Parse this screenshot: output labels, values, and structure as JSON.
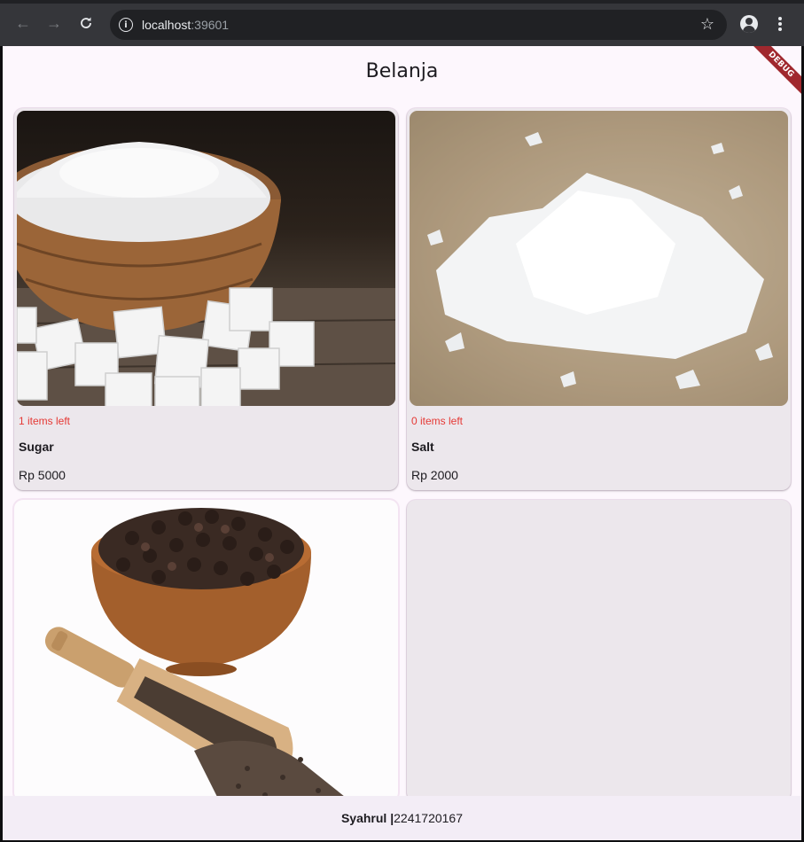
{
  "browser": {
    "url_host": "localhost",
    "url_port": ":39601",
    "back_icon": "arrow-left-icon",
    "forward_icon": "arrow-right-icon",
    "reload_icon": "reload-icon",
    "info_icon": "info-icon",
    "star_icon": "star-icon",
    "profile_icon": "profile-icon",
    "menu_icon": "kebab-menu-icon"
  },
  "app": {
    "title": "Belanja",
    "debug_banner": "DEBUG"
  },
  "products": [
    {
      "name": "Sugar",
      "stock_text": "1 items left",
      "price_text": "Rp 5000",
      "image": "sugar-image"
    },
    {
      "name": "Salt",
      "stock_text": "0 items left",
      "price_text": "Rp 2000",
      "image": "salt-image"
    },
    {
      "name": "",
      "stock_text": "",
      "price_text": "",
      "image": "pepper-image"
    },
    {
      "name": "",
      "stock_text": "",
      "price_text": "",
      "image": ""
    }
  ],
  "footer": {
    "name": "Syahrul |",
    "id": " 2241720167"
  },
  "colors": {
    "stock_text": "#e53935",
    "app_background": "#fdf7fd",
    "card_background": "#ece7ec",
    "debug_banner": "#a0282e"
  }
}
